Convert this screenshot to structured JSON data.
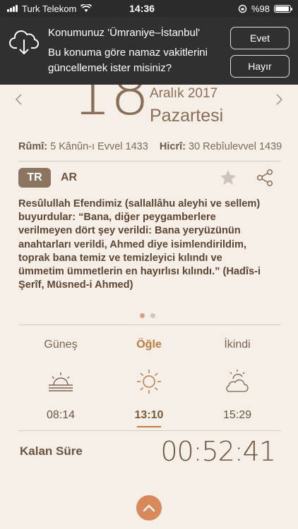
{
  "status_bar": {
    "carrier": "Turk Telekom",
    "time": "14:36",
    "battery": "%98"
  },
  "banner": {
    "title": "Konumunuz 'Ümraniye–İstanbul'",
    "message": "Bu konuma göre namaz vakitlerini güncellemek ister misiniz?",
    "yes_label": "Evet",
    "no_label": "Hayır"
  },
  "date": {
    "day": "18",
    "month_year": "Aralık 2017",
    "weekday": "Pazartesi",
    "rumi_label": "Rûmî:",
    "rumi_value": "5 Kânûn-ı Evvel 1433",
    "hicri_label": "Hicrî:",
    "hicri_value": "30 Rebîulevvel 1439"
  },
  "lang": {
    "tr": "TR",
    "ar": "AR"
  },
  "hadith": {
    "text": "Resûlullah Efendimiz (sallallâhu aleyhi ve sellem) buyurdular: “Bana, diğer peygamberlere verilmeyen dört şey verildi: Bana yeryüzünün anahtarları verildi, Ahmed diye isimlendirildim, toprak bana temiz ve temizleyici kılındı ve ümmetim ümmetlerin en hayırlısı kılındı.” (Hadîs-i Şerîf, Müsned-i Ahmed)"
  },
  "prayers": [
    {
      "name": "Güneş",
      "time": "08:14",
      "icon": "sunrise-icon"
    },
    {
      "name": "Öğle",
      "time": "13:10",
      "icon": "sun-icon",
      "active": true
    },
    {
      "name": "İkindi",
      "time": "15:29",
      "icon": "partly-cloudy-icon"
    }
  ],
  "remaining": {
    "label": "Kalan Süre",
    "time": "00:52:41"
  },
  "colors": {
    "background": "#f5efe7",
    "accent": "#c07a40",
    "banner": "#303030"
  }
}
